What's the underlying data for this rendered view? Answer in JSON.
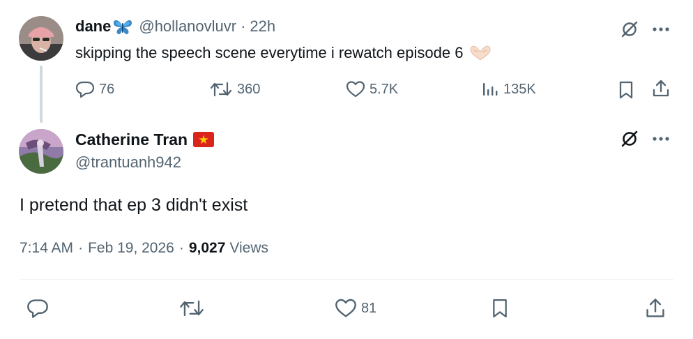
{
  "parent_tweet": {
    "author_name": "dane",
    "handle": "@hollanovluvr",
    "separator": "·",
    "time": "22h",
    "text": "skipping the speech scene everytime i rewatch episode 6",
    "emoji_name_icon": "butterfly-icon",
    "emoji_text_icon": "heart-hands-icon",
    "replies": "76",
    "reposts": "360",
    "likes": "5.7K",
    "views": "135K"
  },
  "main_tweet": {
    "author_name": "Catherine Tran",
    "flag_icon": "vietnam-flag-icon",
    "handle": "@trantuanh942",
    "text": "I pretend that ep 3 didn't exist",
    "time": "7:14 AM",
    "separator": "·",
    "date": "Feb 19, 2026",
    "views_count": "9,027",
    "views_label": "Views",
    "likes": "81"
  },
  "colors": {
    "text_primary": "#0f1419",
    "text_secondary": "#536471",
    "divider": "#eff3f4",
    "thread_line": "#cfd9de"
  }
}
